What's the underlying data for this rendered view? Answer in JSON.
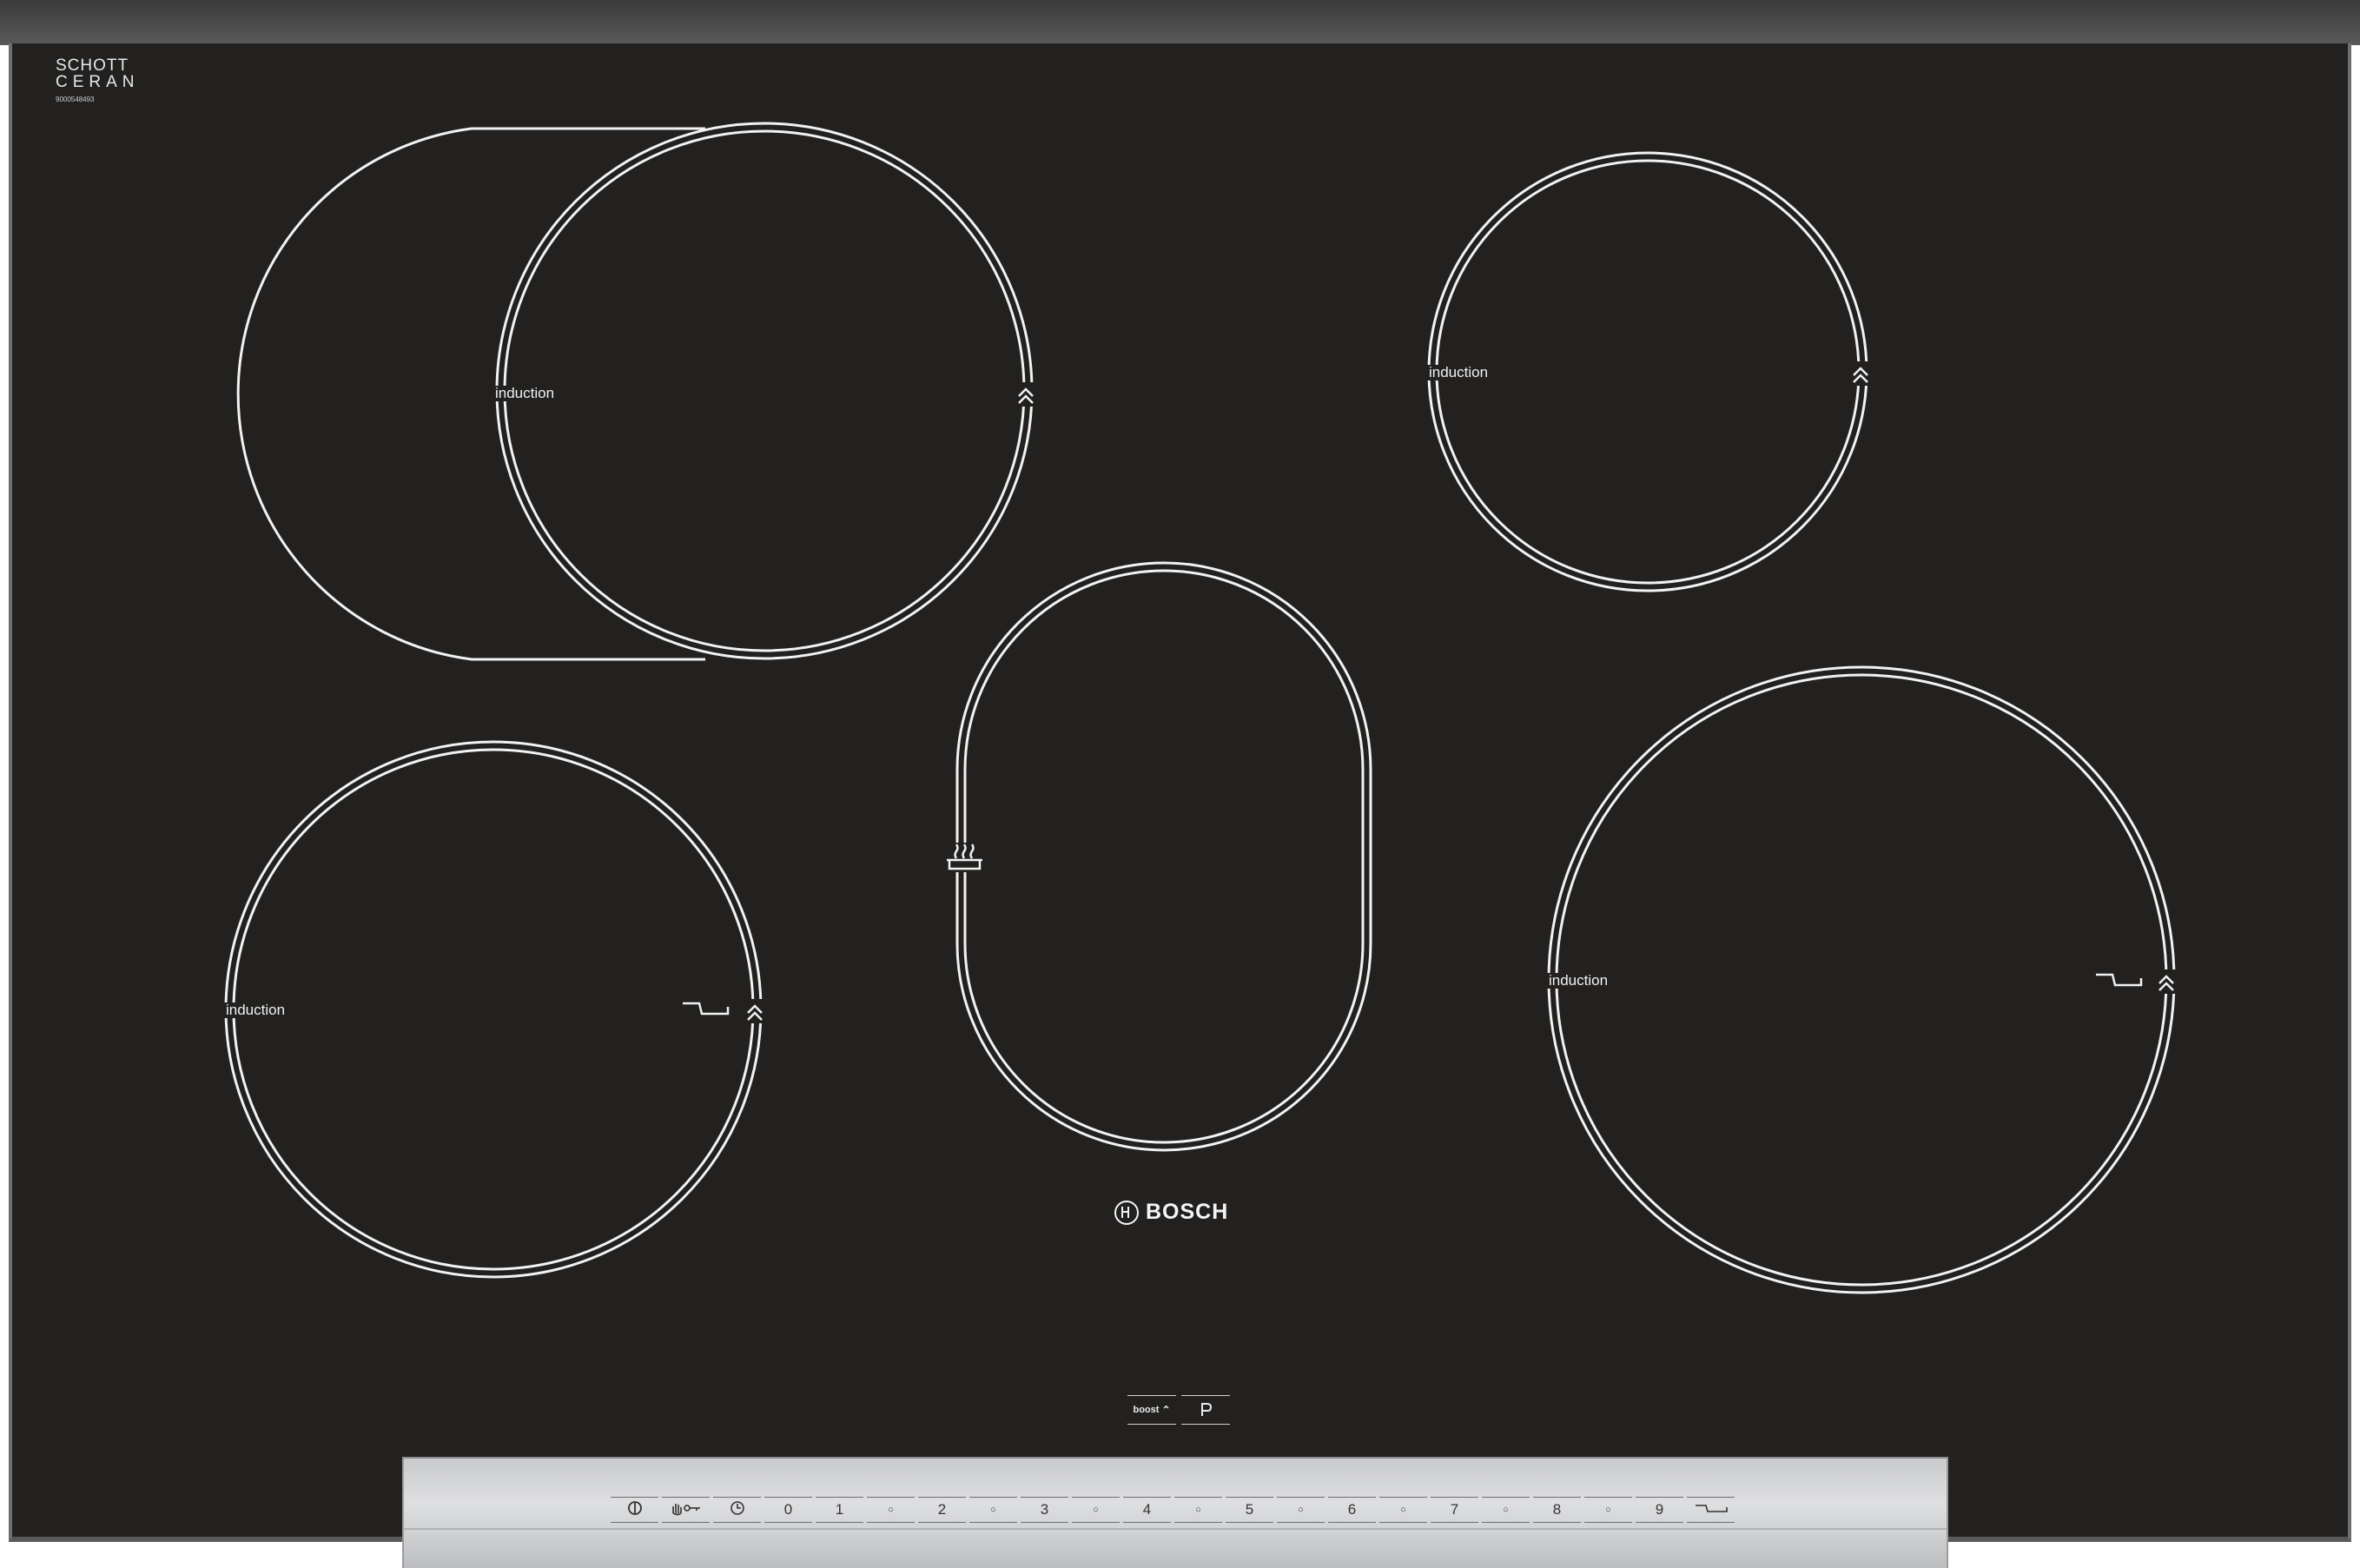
{
  "brand": {
    "glass_maker_line1": "SCHOTT",
    "glass_maker_line2": "CERAN",
    "serial": "9000548493",
    "logo": "BOSCH"
  },
  "zones": [
    {
      "id": "zone-left-flex",
      "label": "induction"
    },
    {
      "id": "zone-top-right",
      "label": "induction"
    },
    {
      "id": "zone-bottom-left",
      "label": "induction"
    },
    {
      "id": "zone-center-oval",
      "label": ""
    },
    {
      "id": "zone-bottom-right",
      "label": "induction"
    }
  ],
  "boost": {
    "label": "boost"
  },
  "controls": {
    "keys": [
      {
        "name": "power-button",
        "icon": "power-icon",
        "label": ""
      },
      {
        "name": "child-lock-button",
        "icon": "hand-key-icon",
        "label": ""
      },
      {
        "name": "timer-button",
        "icon": "clock-icon",
        "label": ""
      },
      {
        "name": "level-0",
        "label": "0"
      },
      {
        "name": "level-1",
        "label": "1"
      },
      {
        "name": "level-1-5",
        "label": "○"
      },
      {
        "name": "level-2",
        "label": "2"
      },
      {
        "name": "level-2-5",
        "label": "○"
      },
      {
        "name": "level-3",
        "label": "3"
      },
      {
        "name": "level-3-5",
        "label": "○"
      },
      {
        "name": "level-4",
        "label": "4"
      },
      {
        "name": "level-4-5",
        "label": "○"
      },
      {
        "name": "level-5",
        "label": "5"
      },
      {
        "name": "level-5-5",
        "label": "○"
      },
      {
        "name": "level-6",
        "label": "6"
      },
      {
        "name": "level-6-5",
        "label": "○"
      },
      {
        "name": "level-7",
        "label": "7"
      },
      {
        "name": "level-7-5",
        "label": "○"
      },
      {
        "name": "level-8",
        "label": "8"
      },
      {
        "name": "level-8-5",
        "label": "○"
      },
      {
        "name": "level-9",
        "label": "9"
      },
      {
        "name": "frying-sensor-button",
        "icon": "pan-icon",
        "label": ""
      }
    ]
  },
  "colors": {
    "glass": "#222120",
    "lines": "#f2f2f2",
    "panel": "#d4d5d7"
  }
}
